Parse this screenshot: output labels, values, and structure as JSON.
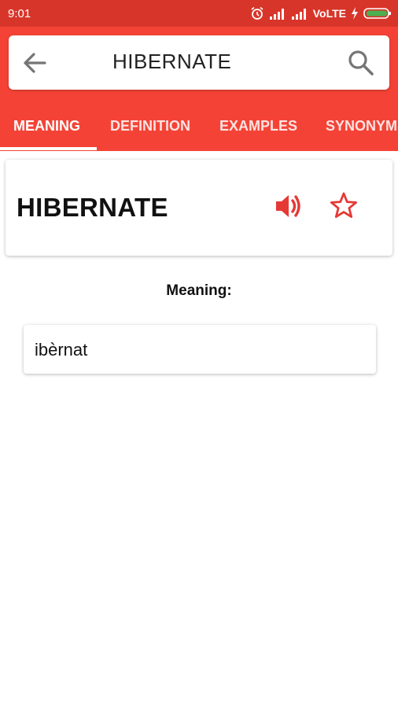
{
  "status_bar": {
    "time": "9:01",
    "network": "VoLTE",
    "icons": [
      "alarm-icon",
      "signal-icon",
      "signal-icon",
      "charging-icon",
      "battery-icon"
    ]
  },
  "search": {
    "query": "HIBERNATE",
    "back_icon": "back-arrow-icon",
    "search_icon": "search-icon"
  },
  "tabs": [
    {
      "label": "MEANING",
      "active": true
    },
    {
      "label": "DEFINITION",
      "active": false
    },
    {
      "label": "EXAMPLES",
      "active": false
    },
    {
      "label": "SYNONYMS",
      "active": false
    }
  ],
  "word_card": {
    "word": "HIBERNATE",
    "speaker_icon": "speaker-icon",
    "favorite_icon": "star-icon"
  },
  "meaning": {
    "label": "Meaning:",
    "text": "ibèrnat"
  },
  "colors": {
    "status_bar": "#d8352a",
    "app_bar": "#f44336",
    "accent": "#e53935"
  }
}
